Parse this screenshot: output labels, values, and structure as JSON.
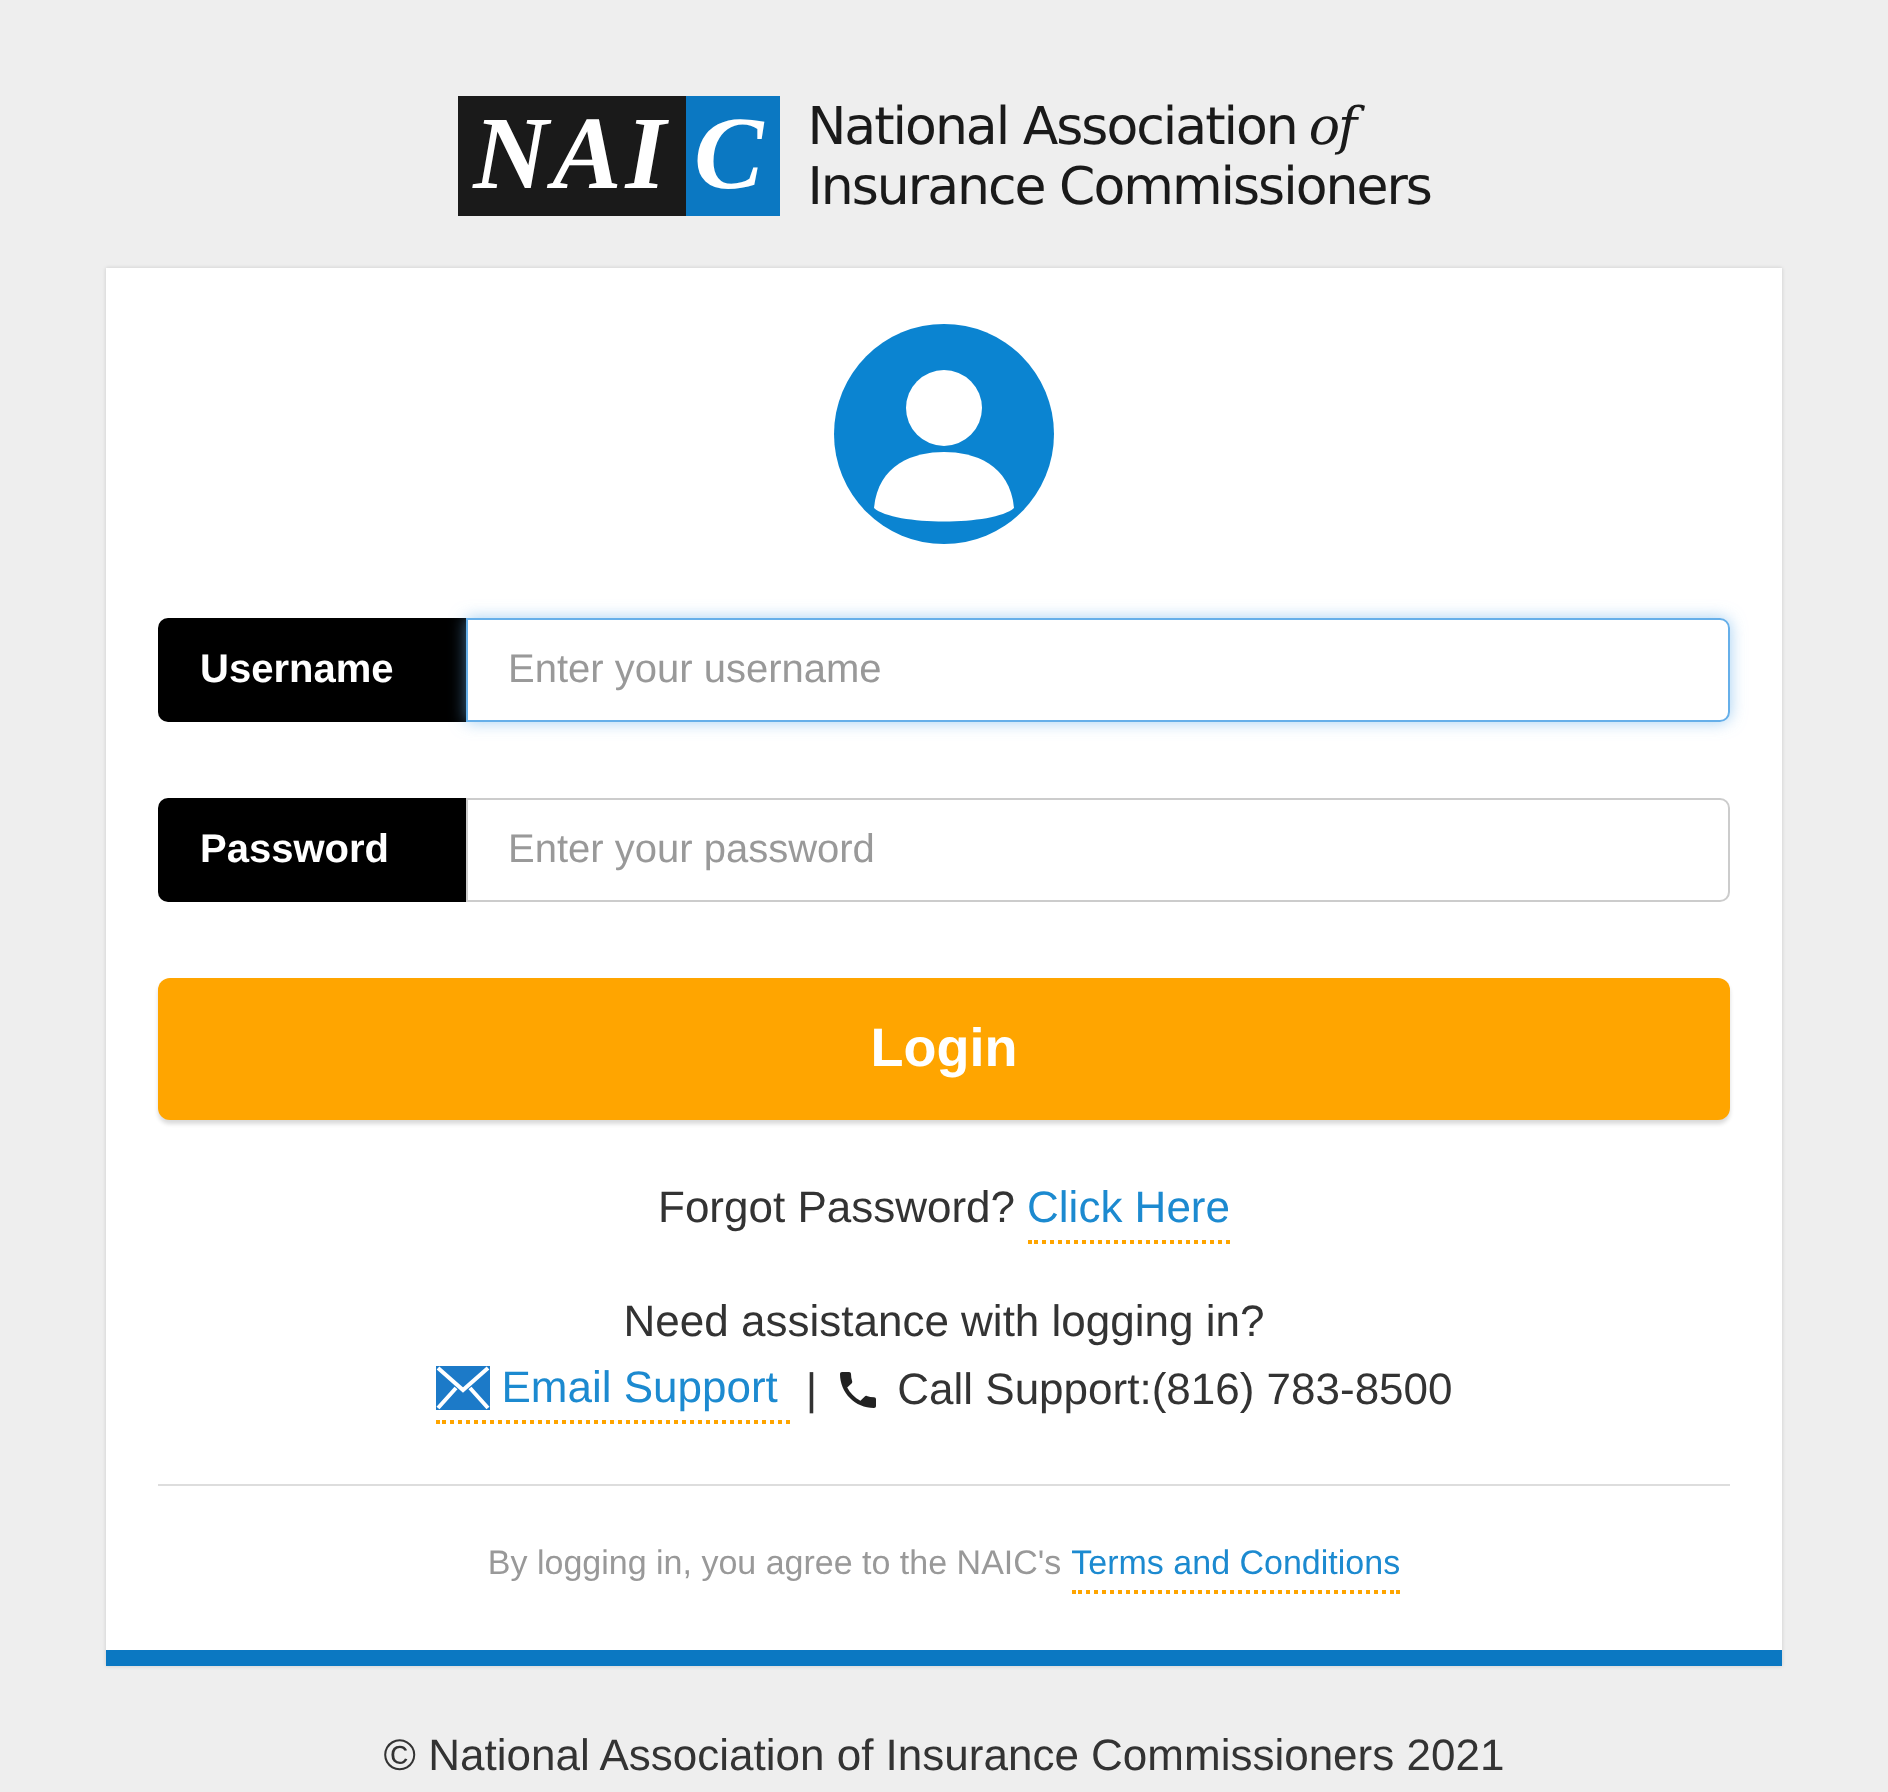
{
  "logo": {
    "mark_dark": "NAI",
    "mark_light": "C",
    "name_line_1": "National Association",
    "name_of": "of",
    "name_line_2": "Insurance Commissioners"
  },
  "fields": [
    {
      "label": "Username",
      "placeholder": "Enter your username",
      "focused": true
    },
    {
      "label": "Password",
      "placeholder": "Enter your password",
      "focused": false
    }
  ],
  "login_button": "Login",
  "forgot": {
    "text": "Forgot Password?",
    "link": "Click Here"
  },
  "assistance": {
    "text": "Need assistance with logging in?",
    "email_link": "Email Support",
    "separator": "|",
    "call": "Call Support:(816) 783-8500"
  },
  "terms": {
    "text": "By logging in, you agree to the NAIC's",
    "link": "Terms and Conditions"
  },
  "footer": "© National Association of Insurance Commissioners 2021"
}
